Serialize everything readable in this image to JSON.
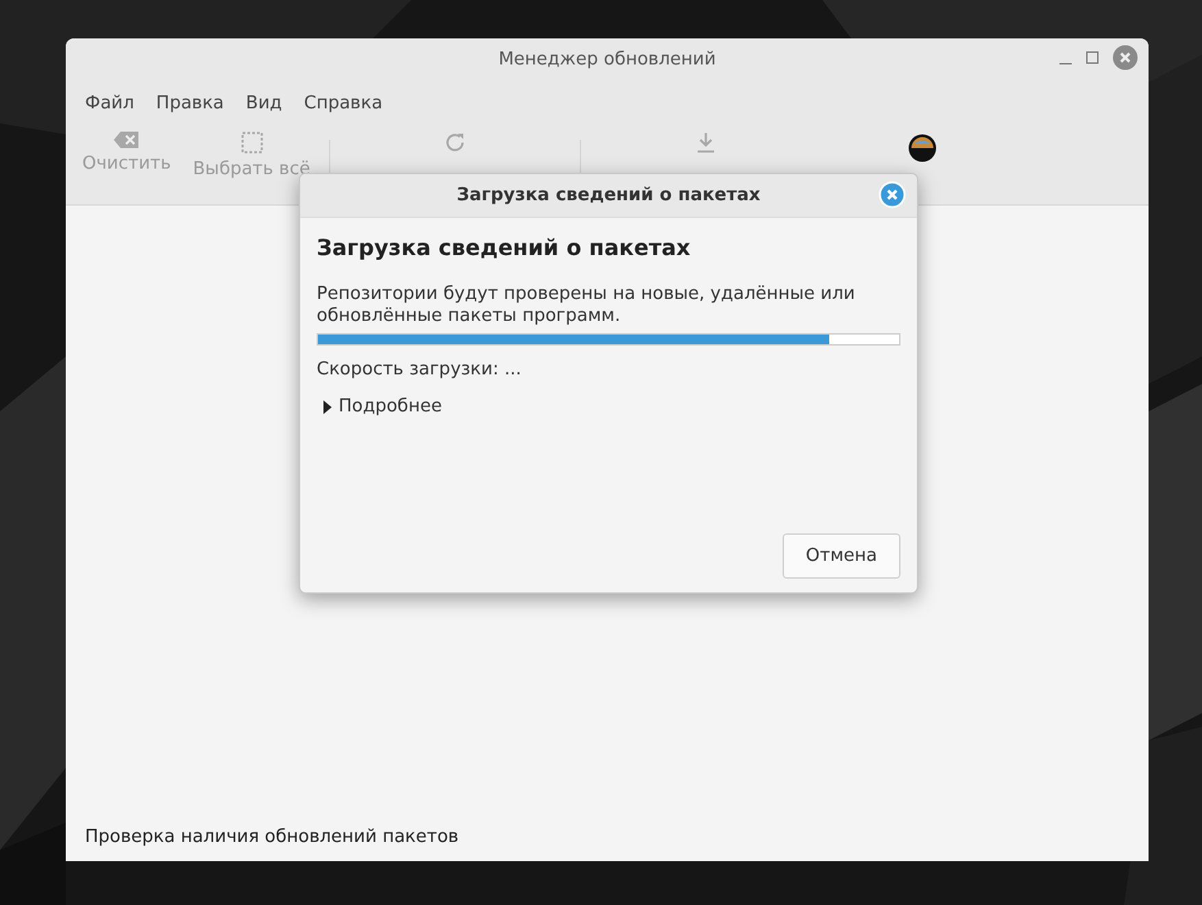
{
  "window": {
    "title": "Менеджер обновлений"
  },
  "menu": [
    "Файл",
    "Правка",
    "Вид",
    "Справка"
  ],
  "toolbar": [
    {
      "kind": "clear",
      "label": "Очистить",
      "disabled": true
    },
    {
      "kind": "select",
      "label": "Выбрать всё",
      "disabled": true
    },
    {
      "kind": "separator"
    },
    {
      "kind": "refresh",
      "disabled": true
    },
    {
      "kind": "separator"
    },
    {
      "kind": "install",
      "disabled": true
    },
    {
      "kind": "status"
    }
  ],
  "status_bar": "Проверка наличия обновлений пакетов",
  "dialog": {
    "title": "Загрузка сведений о пакетах",
    "heading": "Загрузка сведений о пакетах",
    "message": "Репозитории будут проверены на новые, удалённые или обновлённые пакеты программ.",
    "progress": {
      "level": 0.88
    },
    "speed": "Скорость загрузки: ...",
    "details": {
      "label": "Подробнее",
      "expanded": false
    },
    "buttons": [
      "Отмена"
    ]
  }
}
